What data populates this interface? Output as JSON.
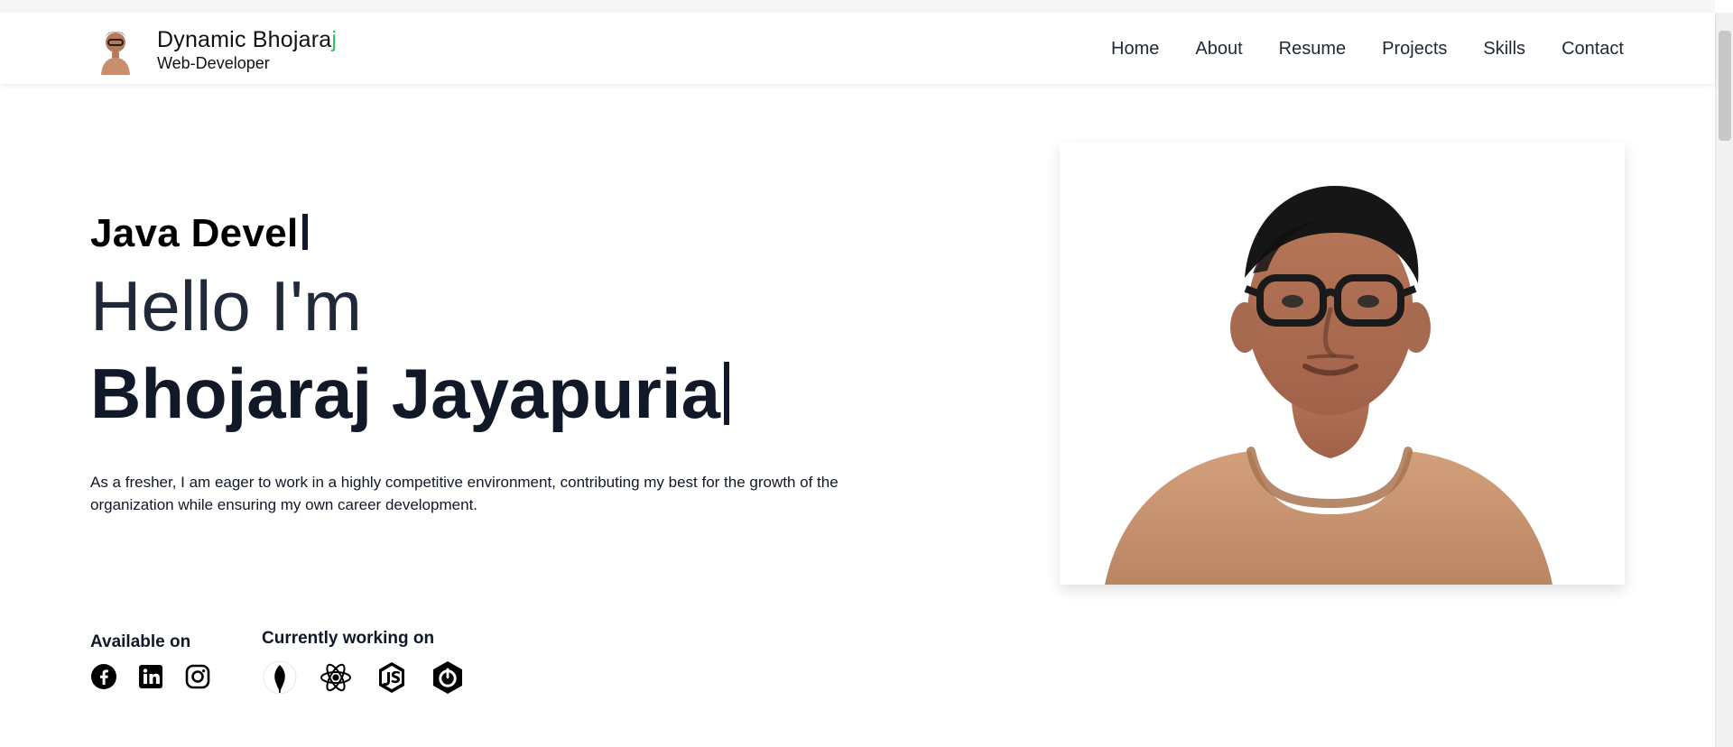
{
  "brand": {
    "title_main": "Dynamic Bhojara",
    "title_accent": "j",
    "subtitle": "Web-Developer"
  },
  "nav": {
    "items": [
      "Home",
      "About",
      "Resume",
      "Projects",
      "Skills",
      "Contact"
    ]
  },
  "hero": {
    "typed_role": "Java Devel",
    "hello": "Hello I'm",
    "name": "Bhojaraj Jayapuria",
    "description": "As a fresher, I am eager to work in a highly competitive environment, contributing my best for the growth of the organization while ensuring my own career development."
  },
  "socials": {
    "heading": "Available on",
    "items": [
      "facebook-icon",
      "linkedin-icon",
      "instagram-icon"
    ]
  },
  "working_on": {
    "heading": "Currently working on",
    "items": [
      "mongodb-icon",
      "react-icon",
      "nodejs-icon",
      "springboot-icon"
    ]
  },
  "colors": {
    "accent_green": "#22c55e",
    "text_dark": "#111827",
    "skin": "#c98f6c",
    "shirt": "#c58f6a"
  }
}
